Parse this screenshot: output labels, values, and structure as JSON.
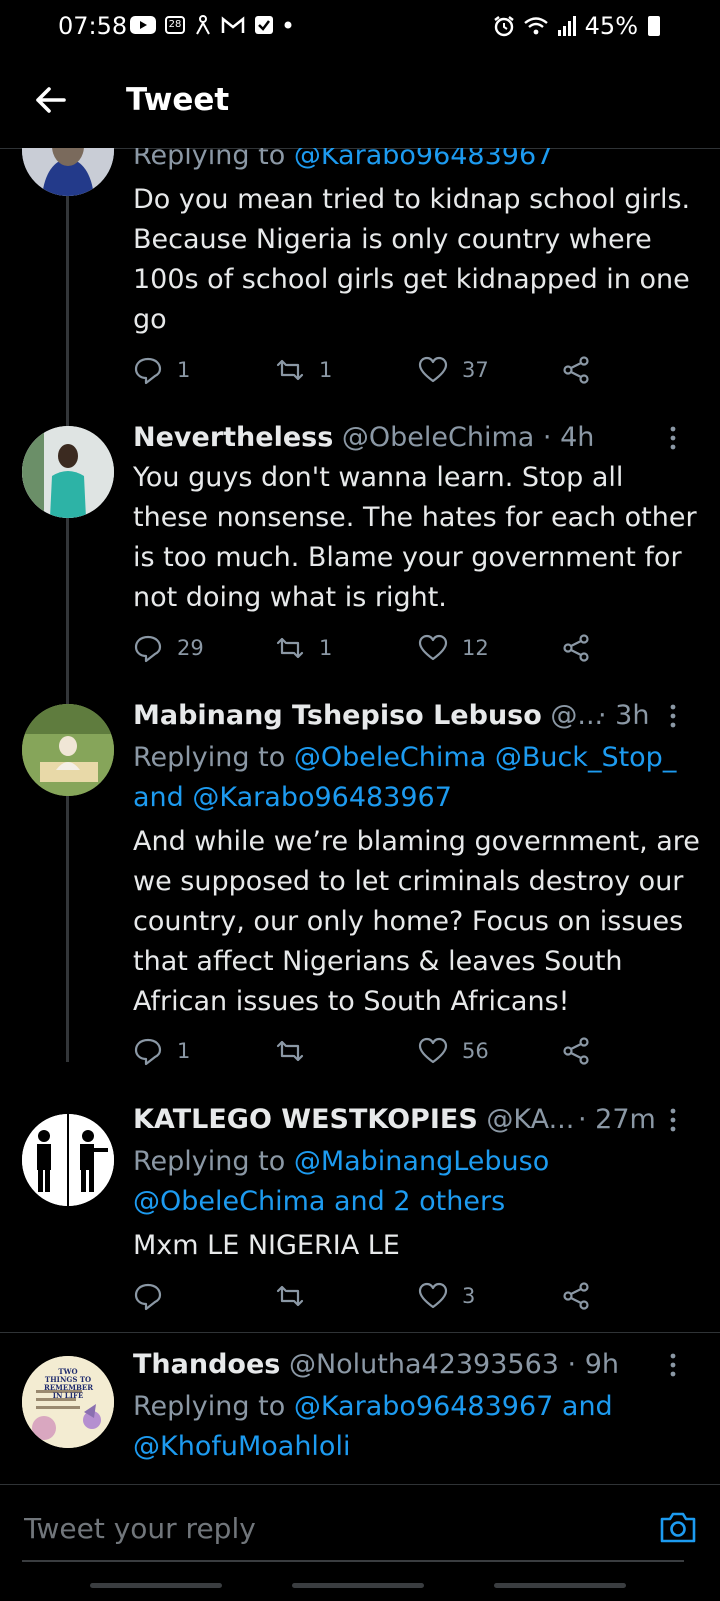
{
  "status_bar": {
    "time": "07:58",
    "calendar_day": "28",
    "battery": "45%",
    "icons": [
      "youtube-icon",
      "calendar-icon",
      "notification-icon",
      "gmail-icon",
      "check-icon",
      "dot-icon",
      "alarm-icon",
      "wifi-icon",
      "signal-icon",
      "battery-icon"
    ]
  },
  "header": {
    "title": "Tweet"
  },
  "tweets": [
    {
      "reply_prefix": "Replying to",
      "reply_to": "@Karabo96483967",
      "text": "Do you mean tried to kidnap school girls. Because Nigeria is only country where 100s of school girls get kidnapped in one go",
      "replies": "1",
      "retweets": "1",
      "likes": "37"
    },
    {
      "name": "Nevertheless",
      "handle": "@ObeleChima",
      "time": "· 4h",
      "text": "You guys don't wanna learn. Stop all these nonsense. The hates for each other is too much. Blame your government for not doing what is right.",
      "replies": "29",
      "retweets": "1",
      "likes": "12"
    },
    {
      "name": "Mabinang Tshepiso Lebuso",
      "handle": "@...",
      "time": "· 3h",
      "reply_prefix": "Replying to",
      "reply_to_1": "@ObeleChima @Buck_Stop_",
      "reply_and": "and",
      "reply_to_2": "@Karabo96483967",
      "text": "And while we’re blaming government, are we supposed to let criminals destroy our country, our only home? Focus on issues that affect Nigerians & leaves South African issues to South Africans!",
      "replies": "1",
      "retweets": "",
      "likes": "56"
    },
    {
      "name": "KATLEGO WESTKOPIES",
      "handle": "@KA...",
      "time": "· 27m",
      "reply_prefix": "Replying to",
      "reply_to_1": "@MabinangLebuso",
      "reply_to_2": "@ObeleChima and 2 others",
      "text": "Mxm LE NIGERIA LE",
      "replies": "",
      "retweets": "",
      "likes": "3"
    },
    {
      "name": "Thandoes",
      "handle": "@Nolutha42393563",
      "time": "· 9h",
      "reply_prefix": "Replying to",
      "reply_to_1": "@Karabo96483967 and",
      "reply_to_2": "@KhofuMoahloli",
      "avatar_text": "TWO THINGS TO REMEMBER IN LIFE"
    }
  ],
  "composer": {
    "placeholder": "Tweet your reply"
  },
  "colors": {
    "background": "#000000",
    "text": "#e7e9ea",
    "secondary": "#8b98a5",
    "accent": "#1d9bf0"
  }
}
